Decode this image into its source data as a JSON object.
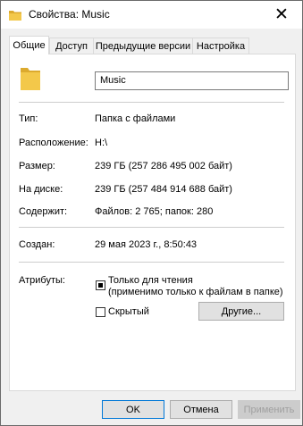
{
  "window": {
    "title": "Свойства: Music",
    "close_glyph": "✕"
  },
  "tabs": [
    {
      "label": "Общие",
      "active": true
    },
    {
      "label": "Доступ",
      "active": false
    },
    {
      "label": "Предыдущие версии",
      "active": false
    },
    {
      "label": "Настройка",
      "active": false
    }
  ],
  "general": {
    "name_value": "Music",
    "type_label": "Тип:",
    "type_value": "Папка с файлами",
    "location_label": "Расположение:",
    "location_value": "H:\\",
    "size_label": "Размер:",
    "size_value": "239 ГБ (257 286 495 002 байт)",
    "disk_label": "На диске:",
    "disk_value": "239 ГБ (257 484 914 688 байт)",
    "contains_label": "Содержит:",
    "contains_value": "Файлов: 2 765; папок: 280",
    "created_label": "Создан:",
    "created_value": "29 мая 2023 г., 8:50:43",
    "attributes_label": "Атрибуты:",
    "readonly_label_1": "Только для чтения",
    "readonly_label_2": "(применимо только к файлам в папке)",
    "readonly_state": "indeterminate",
    "hidden_label": "Скрытый",
    "hidden_state": "unchecked",
    "advanced_button": "Другие..."
  },
  "footer": {
    "ok": "OK",
    "cancel": "Отмена",
    "apply": "Применить"
  },
  "colors": {
    "folder": "#f3c84a",
    "folder_dark": "#dcaa2e",
    "accent": "#0078d7"
  },
  "icons": {
    "title_icon": "folder-icon",
    "big_icon": "folder-icon",
    "close": "close-icon"
  }
}
